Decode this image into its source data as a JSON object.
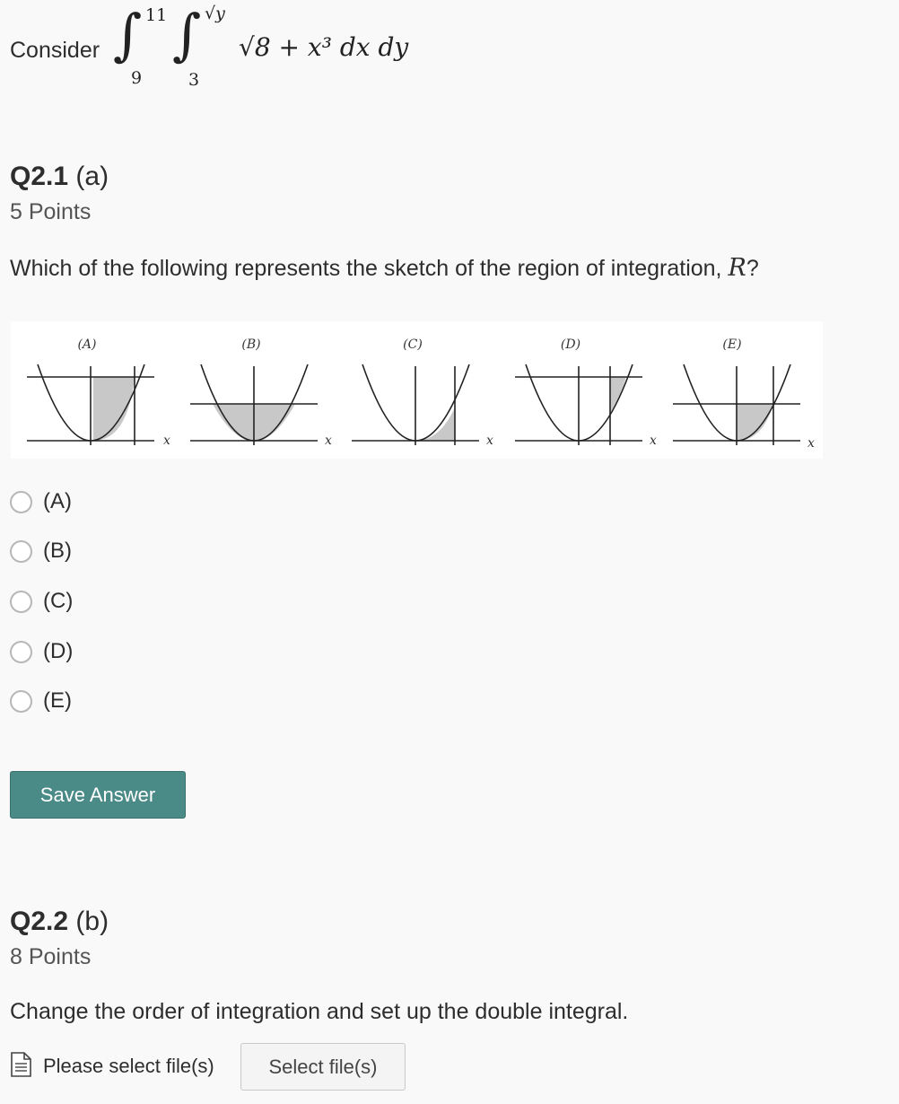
{
  "intro": {
    "prefix": "Consider",
    "outer_upper": "11",
    "outer_lower": "9",
    "inner_upper": "√y",
    "inner_lower": "3",
    "integrand": "√8 + x³ dx dy"
  },
  "q1": {
    "number": "Q2.1",
    "part": "(a)",
    "points": "5 Points",
    "prompt": "Which of the following represents the sketch of the region of integration,",
    "region_symbol": "R",
    "prompt_end": "?",
    "panels": [
      {
        "label": "(A)",
        "axis": "x"
      },
      {
        "label": "(B)",
        "axis": "x"
      },
      {
        "label": "(C)",
        "axis": "x"
      },
      {
        "label": "(D)",
        "axis": "x"
      },
      {
        "label": "(E)",
        "axis": "x"
      }
    ],
    "choices": [
      "(A)",
      "(B)",
      "(C)",
      "(D)",
      "(E)"
    ],
    "save_label": "Save Answer"
  },
  "q2": {
    "number": "Q2.2",
    "part": "(b)",
    "points": "8 Points",
    "prompt": "Change the order of integration and set up the double integral.",
    "file_label": "Please select file(s)",
    "select_label": "Select file(s)"
  },
  "icons": {
    "file": "document-icon",
    "radio": "radio-unchecked-icon"
  },
  "colors": {
    "accent": "#4a8a87",
    "region_fill": "#c8c8c8",
    "background": "#f9f9f9"
  }
}
